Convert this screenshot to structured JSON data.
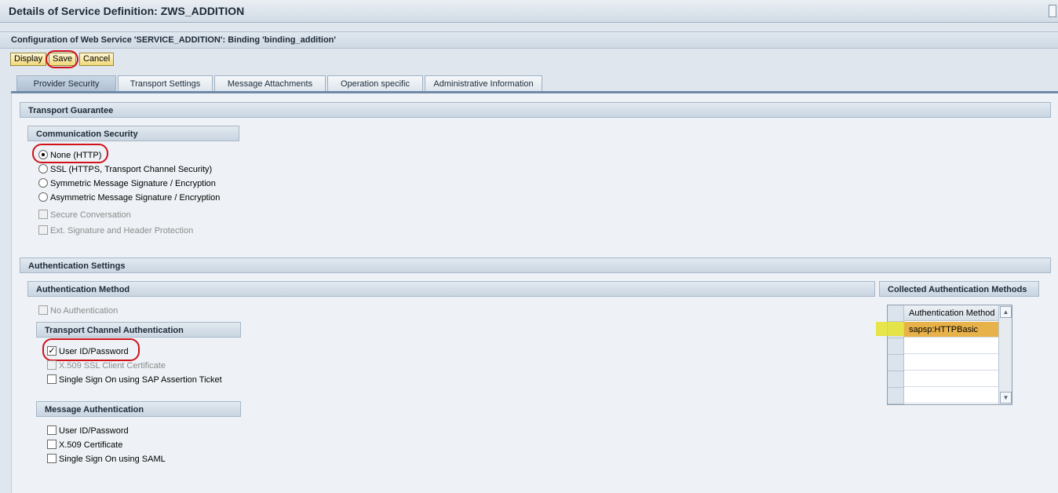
{
  "window": {
    "title": "Details of Service Definition: ZWS_ADDITION"
  },
  "subtitle": "Configuration of Web Service 'SERVICE_ADDITION': Binding 'binding_addition'",
  "toolbar": {
    "display_label": "Display",
    "save_label": "Save",
    "cancel_label": "Cancel"
  },
  "tabs": [
    {
      "label": "Provider Security",
      "active": true
    },
    {
      "label": "Transport Settings"
    },
    {
      "label": "Message Attachments"
    },
    {
      "label": "Operation specific"
    },
    {
      "label": "Administrative Information"
    }
  ],
  "transport_guarantee": {
    "header": "Transport Guarantee",
    "communication_security": {
      "header": "Communication Security",
      "options": [
        {
          "label": "None (HTTP)",
          "selected": true
        },
        {
          "label": "SSL (HTTPS, Transport Channel Security)"
        },
        {
          "label": "Symmetric Message Signature / Encryption"
        },
        {
          "label": "Asymmetric Message Signature / Encryption"
        }
      ],
      "checkboxes": [
        {
          "label": "Secure Conversation",
          "disabled": true
        },
        {
          "label": "Ext. Signature and Header Protection",
          "disabled": true
        }
      ]
    }
  },
  "authentication_settings": {
    "header": "Authentication Settings",
    "method_header": "Authentication Method",
    "no_auth_label": "No Authentication",
    "transport_channel": {
      "header": "Transport Channel Authentication",
      "items": [
        {
          "label": "User ID/Password",
          "checked": true
        },
        {
          "label": "X.509 SSL Client Certificate",
          "disabled": true
        },
        {
          "label": "Single Sign On using SAP Assertion Ticket"
        }
      ]
    },
    "message_auth": {
      "header": "Message Authentication",
      "items": [
        {
          "label": "User ID/Password"
        },
        {
          "label": "X.509 Certificate"
        },
        {
          "label": "Single Sign On using SAML"
        }
      ]
    },
    "collected": {
      "header": "Collected Authentication Methods",
      "column": "Authentication Method",
      "rows": [
        "sapsp:HTTPBasic",
        "",
        "",
        "",
        ""
      ]
    }
  },
  "colors": {
    "highlight_row": "#e8b24a",
    "annotation_red": "#d0121b",
    "marker_yellow": "#e5e32a"
  }
}
